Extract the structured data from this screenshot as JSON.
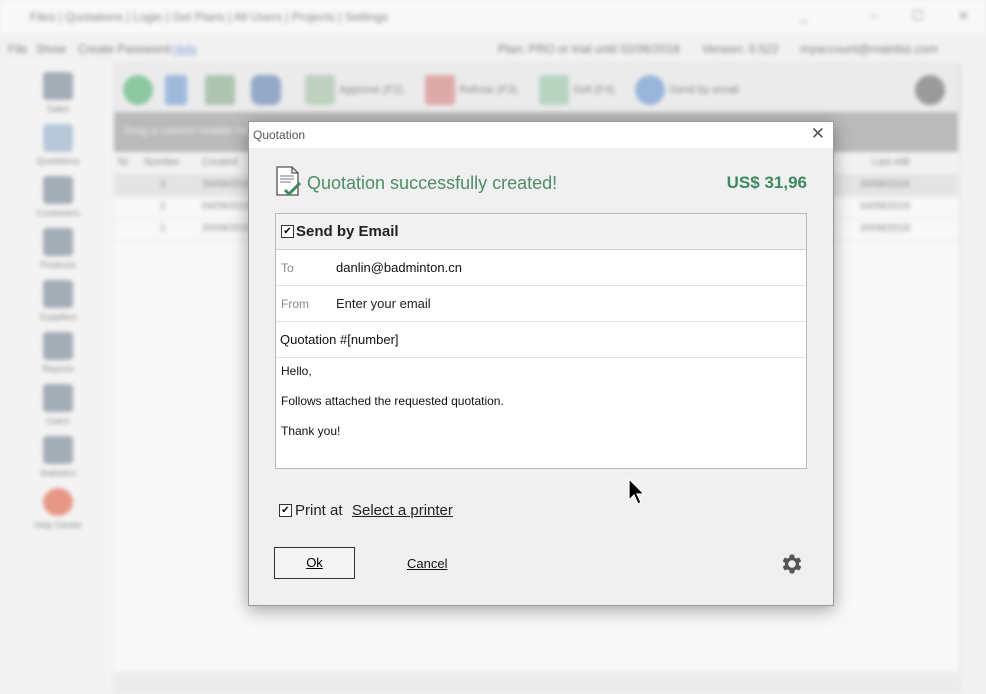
{
  "background_app": {
    "window_title": "Files | Quotations | Login | Get Plans | All Users | Projects | Settings",
    "menu": [
      "File",
      "Show",
      "Create Password"
    ],
    "menu_link": "Help",
    "plan_text": "Plan: PRO or trial until 02/06/2016",
    "version": "Version: 0.522",
    "account": "myaccount@mainbiz.com",
    "sidebar": [
      "Sales",
      "Quotations",
      "Customers",
      "Products",
      "Suppliers",
      "Reports",
      "Users",
      "Statistics",
      "Help Center"
    ],
    "toolbar": [
      "Approve (F2)",
      "Refuse (F3)",
      "Sell (F4)",
      "Send by email"
    ],
    "grouping_hint": "Drag a column header here to group by that column",
    "grid_header": [
      "Nr",
      "Number",
      "Created",
      "Last edit"
    ],
    "grid_rows": [
      [
        "3",
        "20/09/2016",
        "20/08/2016"
      ],
      [
        "2",
        "04/09/2016",
        "04/08/2016"
      ],
      [
        "1",
        "20/09/2016",
        "20/08/2016"
      ]
    ]
  },
  "dialog": {
    "title": "Quotation",
    "success_message": "Quotation successfully created!",
    "amount": "US$ 31,96",
    "email": {
      "send_label": "Send by Email",
      "send_checked": true,
      "to_label": "To",
      "to_value": "danlin@badminton.cn",
      "from_label": "From",
      "from_placeholder": "Enter your email",
      "subject_value": "Quotation #[number]",
      "body_lines": [
        "Hello,",
        "Follows attached the requested quotation.",
        "Thank you!"
      ]
    },
    "print_label": "Print at",
    "print_checked": true,
    "printer_link": "Select a printer",
    "ok_label": "Ok",
    "cancel_label": "Cancel",
    "accent_color": "#4e8d68"
  }
}
